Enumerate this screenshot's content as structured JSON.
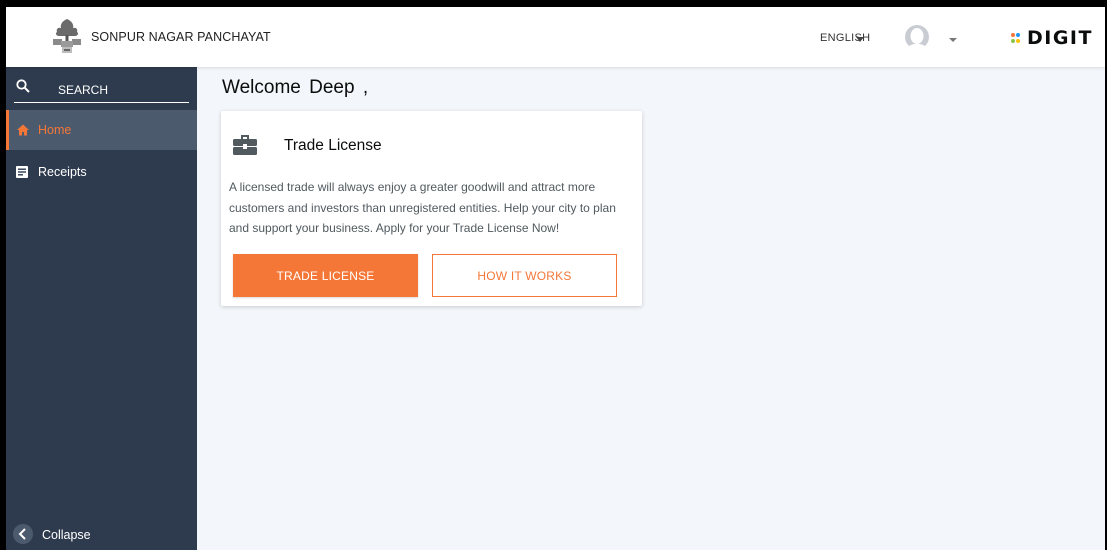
{
  "header": {
    "city_name": "SONPUR NAGAR PANCHAYAT",
    "language": "ENGLISH",
    "brand": "DIGIT"
  },
  "sidebar": {
    "search_label": "SEARCH",
    "items": [
      {
        "label": "Home",
        "icon": "home-icon",
        "active": true
      },
      {
        "label": "Receipts",
        "icon": "receipt-icon",
        "active": false
      }
    ],
    "collapse_label": "Collapse"
  },
  "main": {
    "welcome": "Welcome  Deep  ,",
    "card": {
      "icon": "briefcase-icon",
      "title": "Trade License",
      "description": "A licensed trade will always enjoy a greater goodwill and attract more customers and investors than unregistered entities. Help your city to plan and support your business. Apply for your Trade License Now!",
      "primary_button": "TRADE LICENSE",
      "secondary_button": "HOW IT WORKS"
    }
  },
  "colors": {
    "accent": "#f47738",
    "sidebar_bg": "#2e3b4e",
    "sidebar_active_bg": "#4c5a6d",
    "page_bg": "#f3f6fa"
  }
}
